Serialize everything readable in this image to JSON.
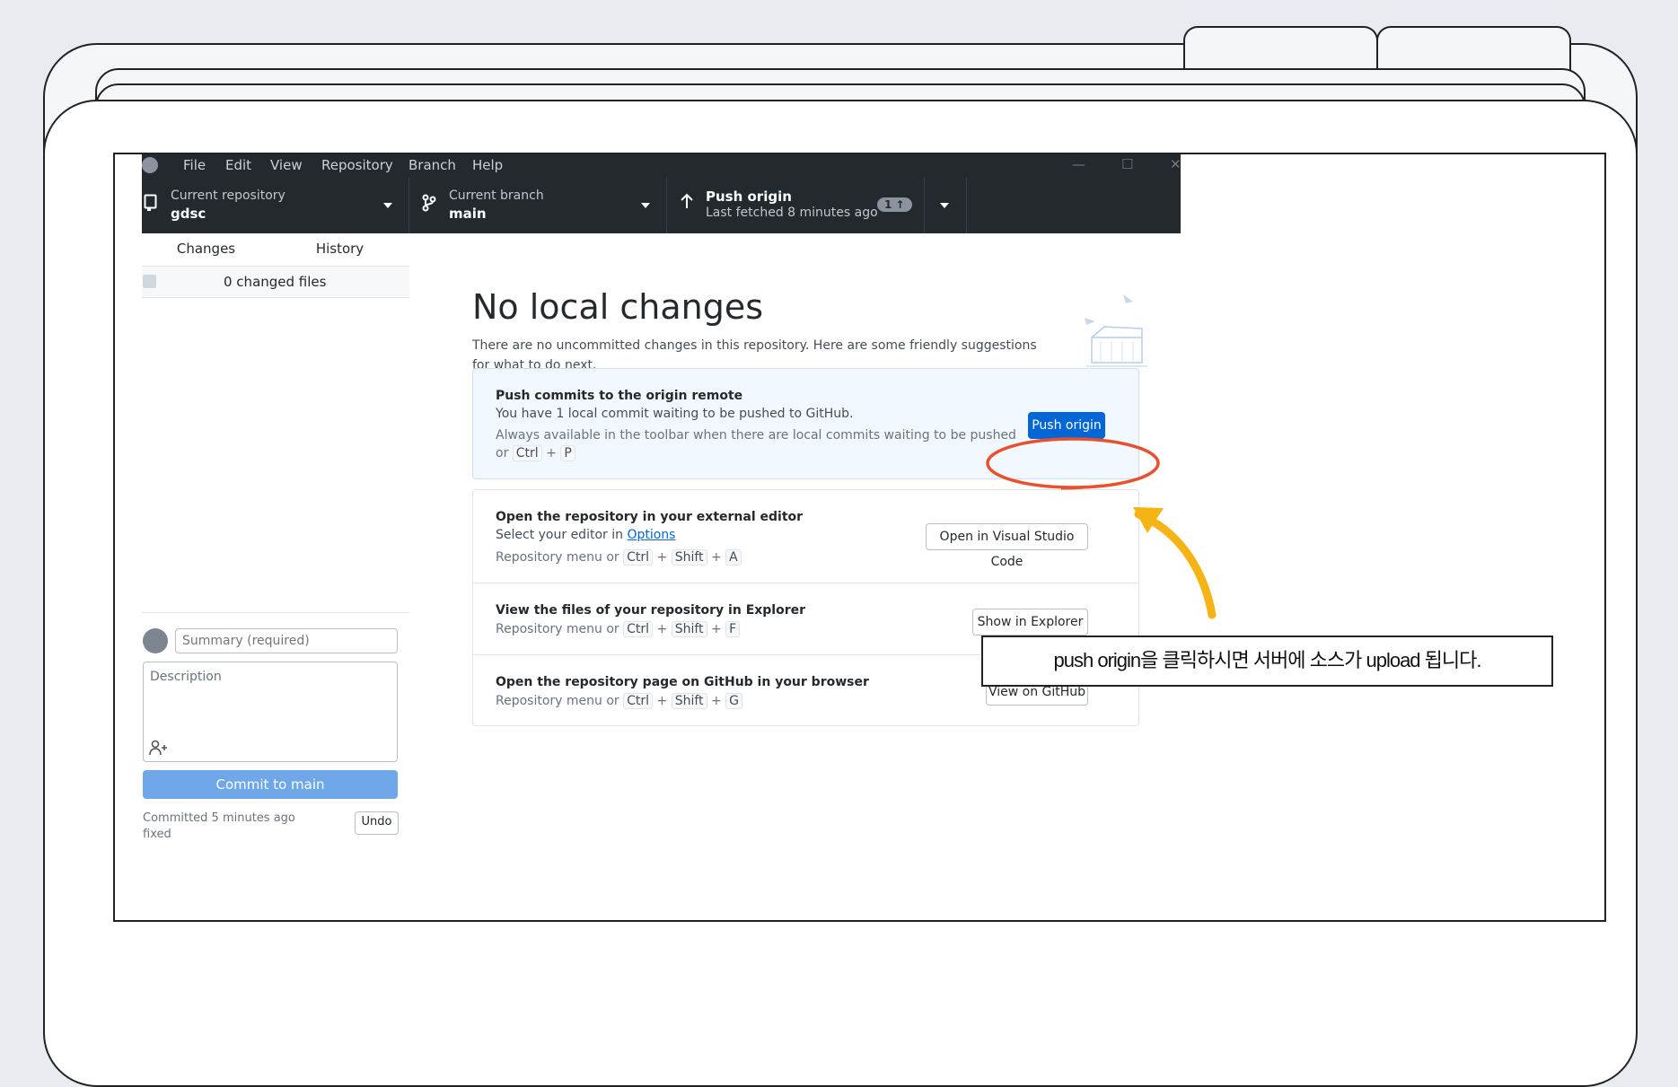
{
  "menu": {
    "items": [
      "File",
      "Edit",
      "View",
      "Repository",
      "Branch",
      "Help"
    ],
    "window_controls": [
      "—",
      "☐",
      "✕"
    ]
  },
  "toolbar": {
    "repo_label": "Current repository",
    "repo_name": "gdsc",
    "branch_label": "Current branch",
    "branch_name": "main",
    "push_title": "Push origin",
    "push_sub": "Last fetched 8 minutes ago",
    "push_badge": "1 ↑"
  },
  "sidebar": {
    "tabs": [
      "Changes",
      "History"
    ],
    "changed_files": "0 changed files",
    "summary_placeholder": "Summary (required)",
    "description_placeholder": "Description",
    "commit_button": "Commit to main",
    "committed_text": "Committed 5 minutes ago",
    "undo_label": "Undo",
    "last_commit": "fixed"
  },
  "main": {
    "title": "No local changes",
    "description": "There are no uncommitted changes in this repository. Here are some friendly suggestions for what to do next.",
    "push_card": {
      "title": "Push commits to the origin remote",
      "text": "You have 1 local commit waiting to be pushed to GitHub.",
      "hint_prefix": "Always available in the toolbar when there are local commits waiting to be pushed",
      "hint_or": "or",
      "keys": [
        "Ctrl",
        "P"
      ],
      "button": "Push origin"
    },
    "editor_card": {
      "title": "Open the repository in your external editor",
      "text_prefix": "Select your editor in",
      "link": "Options",
      "hint": "Repository menu or",
      "keys": [
        "Ctrl",
        "Shift",
        "A"
      ],
      "button": "Open in Visual Studio Code"
    },
    "explorer_card": {
      "title": "View the files of your repository in Explorer",
      "hint": "Repository menu or",
      "keys": [
        "Ctrl",
        "Shift",
        "F"
      ],
      "button": "Show in Explorer"
    },
    "github_card": {
      "title": "Open the repository page on GitHub in your browser",
      "hint": "Repository menu or",
      "keys": [
        "Ctrl",
        "Shift",
        "G"
      ],
      "button": "View on GitHub"
    }
  },
  "annotation": {
    "callout_text": "push origin을 클릭하시면 서버에 소스가 upload 됩니다.",
    "highlight_color": "#e8502e",
    "arrow_color": "#f5b414"
  }
}
